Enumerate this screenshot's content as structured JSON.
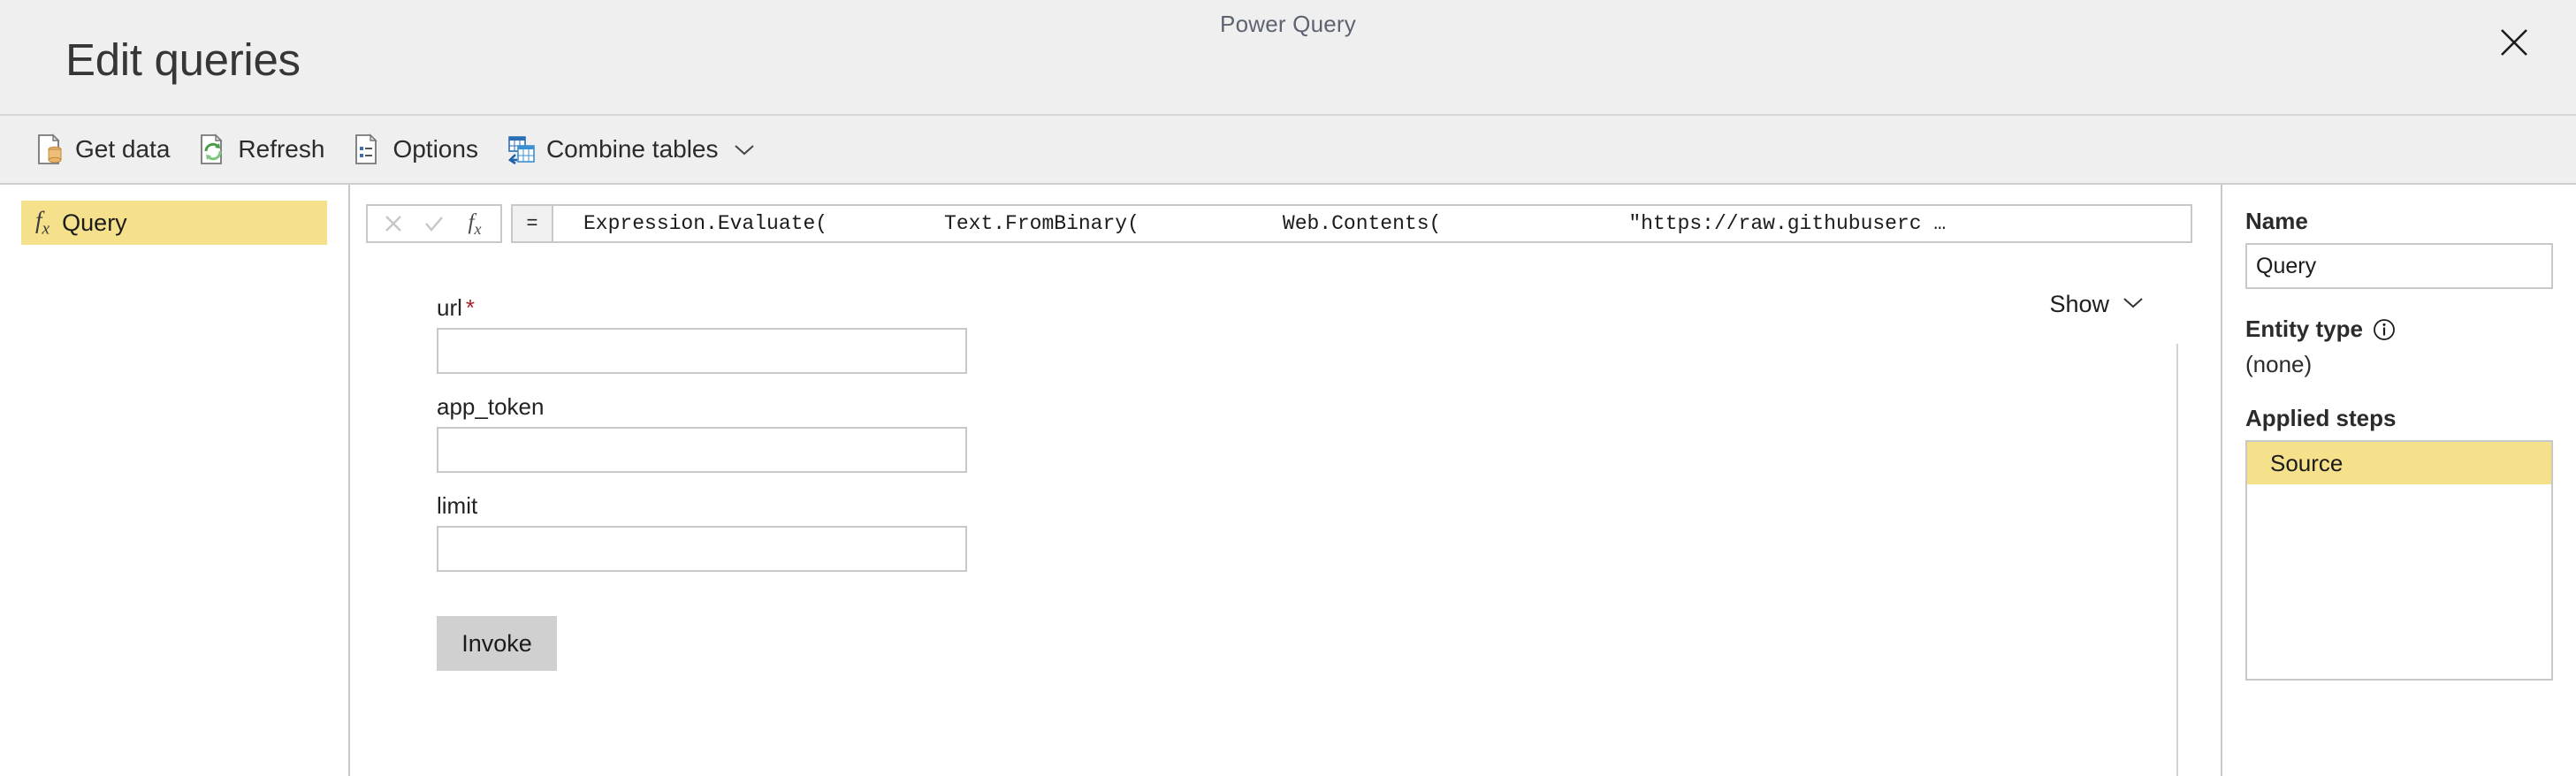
{
  "window": {
    "app_title": "Power Query",
    "page_title": "Edit queries",
    "close_icon": "close-icon"
  },
  "toolbar": {
    "items": [
      {
        "label": "Get data",
        "icon": "get-data-icon",
        "caret": false
      },
      {
        "label": "Refresh",
        "icon": "refresh-icon",
        "caret": false
      },
      {
        "label": "Options",
        "icon": "options-icon",
        "caret": false
      },
      {
        "label": "Combine tables",
        "icon": "combine-tables-icon",
        "caret": true
      }
    ]
  },
  "sidebar": {
    "queries": [
      {
        "label": "Query",
        "icon": "fx-icon",
        "selected": true
      }
    ]
  },
  "formula_bar": {
    "cancel_icon": "cancel-icon",
    "accept_icon": "accept-icon",
    "fx_icon": "fx-icon",
    "equals": "=",
    "tokens": [
      "Expression.Evaluate(",
      "Text.FromBinary(",
      "Web.Contents(",
      "\"https://raw.githubuserc …"
    ]
  },
  "content": {
    "show_toggle_label": "Show",
    "show_toggle_icon": "chevron-down-icon",
    "fields": [
      {
        "label": "url",
        "required": true,
        "value": "",
        "placeholder": ""
      },
      {
        "label": "app_token",
        "required": false,
        "value": "",
        "placeholder": ""
      },
      {
        "label": "limit",
        "required": false,
        "value": "",
        "placeholder": ""
      }
    ],
    "invoke_label": "Invoke"
  },
  "right_panel": {
    "name_heading": "Name",
    "name_value": "Query",
    "entity_type_heading": "Entity type",
    "entity_type_info_icon": "info-icon",
    "entity_type_value": "(none)",
    "applied_steps_heading": "Applied steps",
    "steps": [
      {
        "label": "Source",
        "selected": true
      }
    ]
  },
  "colors": {
    "highlight": "#F5E08C",
    "chrome": "#EFEFF0",
    "required_star": "#A4262C",
    "button": "#D0D0D0"
  }
}
